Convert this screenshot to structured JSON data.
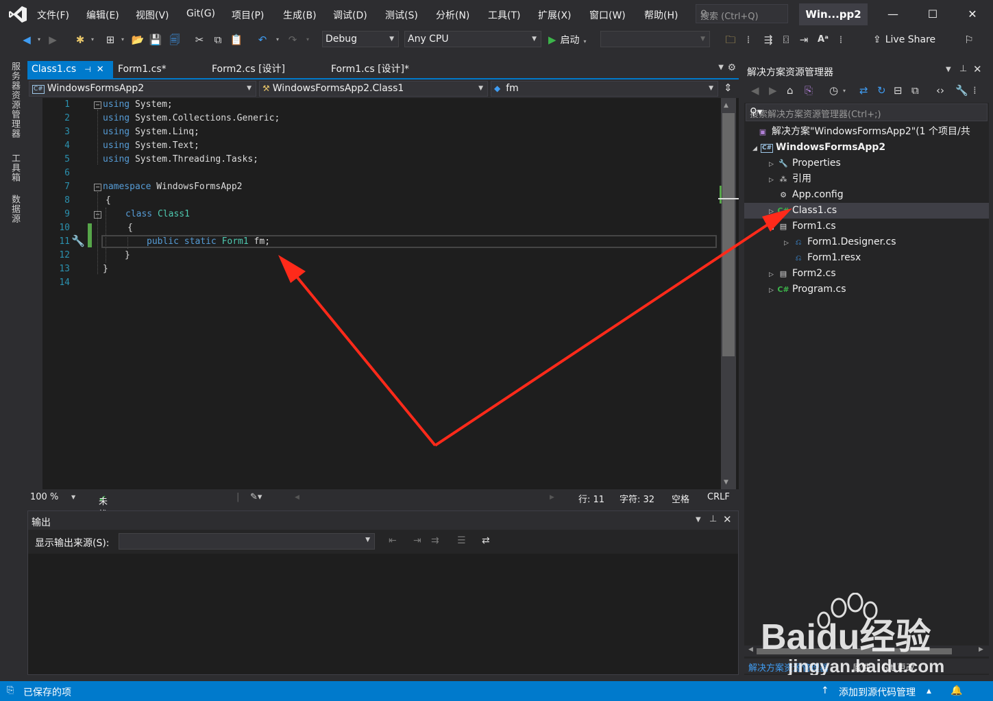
{
  "menubar": {
    "items": [
      "文件(F)",
      "编辑(E)",
      "视图(V)",
      "Git(G)",
      "项目(P)",
      "生成(B)",
      "调试(D)",
      "测试(S)",
      "分析(N)",
      "工具(T)",
      "扩展(X)",
      "窗口(W)",
      "帮助(H)"
    ],
    "search_placeholder": "搜索 (Ctrl+Q)",
    "window_title": "Win...pp2"
  },
  "toolbar": {
    "configuration": "Debug",
    "platform": "Any CPU",
    "start_label": "启动",
    "live_share": "Live Share"
  },
  "side_tabs": [
    "服务器资源管理器",
    "工具箱",
    "数据源"
  ],
  "editor_tabs": [
    {
      "label": "Class1.cs",
      "active": true
    },
    {
      "label": "Form1.cs*",
      "active": false
    },
    {
      "label": "Form2.cs [设计]",
      "active": false
    },
    {
      "label": "Form1.cs [设计]*",
      "active": false
    }
  ],
  "navbar": {
    "project": "WindowsFormsApp2",
    "class": "WindowsFormsApp2.Class1",
    "member": "fm"
  },
  "code": {
    "line_numbers": [
      "1",
      "2",
      "3",
      "4",
      "5",
      "6",
      "7",
      "8",
      "9",
      "10",
      "11",
      "12",
      "13",
      "14"
    ],
    "l1_kw": "using",
    "l1_rest": " System;",
    "l2_kw": "using",
    "l2_rest": " System.Collections.Generic;",
    "l3_kw": "using",
    "l3_rest": " System.Linq;",
    "l4_kw": "using",
    "l4_rest": " System.Text;",
    "l5_kw": "using",
    "l5_rest": " System.Threading.Tasks;",
    "l7_kw": "namespace",
    "l7_rest": " WindowsFormsApp2",
    "l8": "{",
    "l9_kw": "class",
    "l9_type": " Class1",
    "l10": "{",
    "l11_kw": "public static",
    "l11_type": " Form1",
    "l11_rest": " fm;",
    "l12": "}",
    "l13": "}"
  },
  "editor_status": {
    "zoom": "100 %",
    "issues": "未找到相关问题",
    "line": "行: 11",
    "char": "字符: 32",
    "whitespace": "空格",
    "line_ending": "CRLF"
  },
  "output": {
    "title": "输出",
    "source_label": "显示输出来源(S):"
  },
  "solution_explorer": {
    "title": "解决方案资源管理器",
    "search_placeholder": "搜索解决方案资源管理器(Ctrl+;)",
    "tree": [
      {
        "label": "解决方案\"WindowsFormsApp2\"(1 个项目/共",
        "icon": "solution-icon"
      },
      {
        "label": "WindowsFormsApp2",
        "icon": "csharp-project-icon"
      },
      {
        "label": "Properties",
        "icon": "wrench-icon"
      },
      {
        "label": "引用",
        "icon": "references-icon"
      },
      {
        "label": "App.config",
        "icon": "config-file-icon"
      },
      {
        "label": "Class1.cs",
        "icon": "csharp-file-icon"
      },
      {
        "label": "Form1.cs",
        "icon": "form-icon"
      },
      {
        "label": "Form1.Designer.cs",
        "icon": "designer-file-icon"
      },
      {
        "label": "Form1.resx",
        "icon": "resx-file-icon"
      },
      {
        "label": "Form2.cs",
        "icon": "form-icon"
      },
      {
        "label": "Program.cs",
        "icon": "csharp-file-icon"
      }
    ],
    "bottom_tabs": [
      "解决方案资源管理器",
      "属性",
      "Git 更改"
    ]
  },
  "statusbar": {
    "left": "已保存的项",
    "right": "添加到源代码管理"
  },
  "watermark": {
    "brand": "Baidu经验",
    "url": "jingyan.baidu.com"
  },
  "colors": {
    "accent": "#007acc",
    "annotation_arrow": "#ff2a1a",
    "keyword": "#569cd6",
    "type": "#4ec9b0"
  }
}
